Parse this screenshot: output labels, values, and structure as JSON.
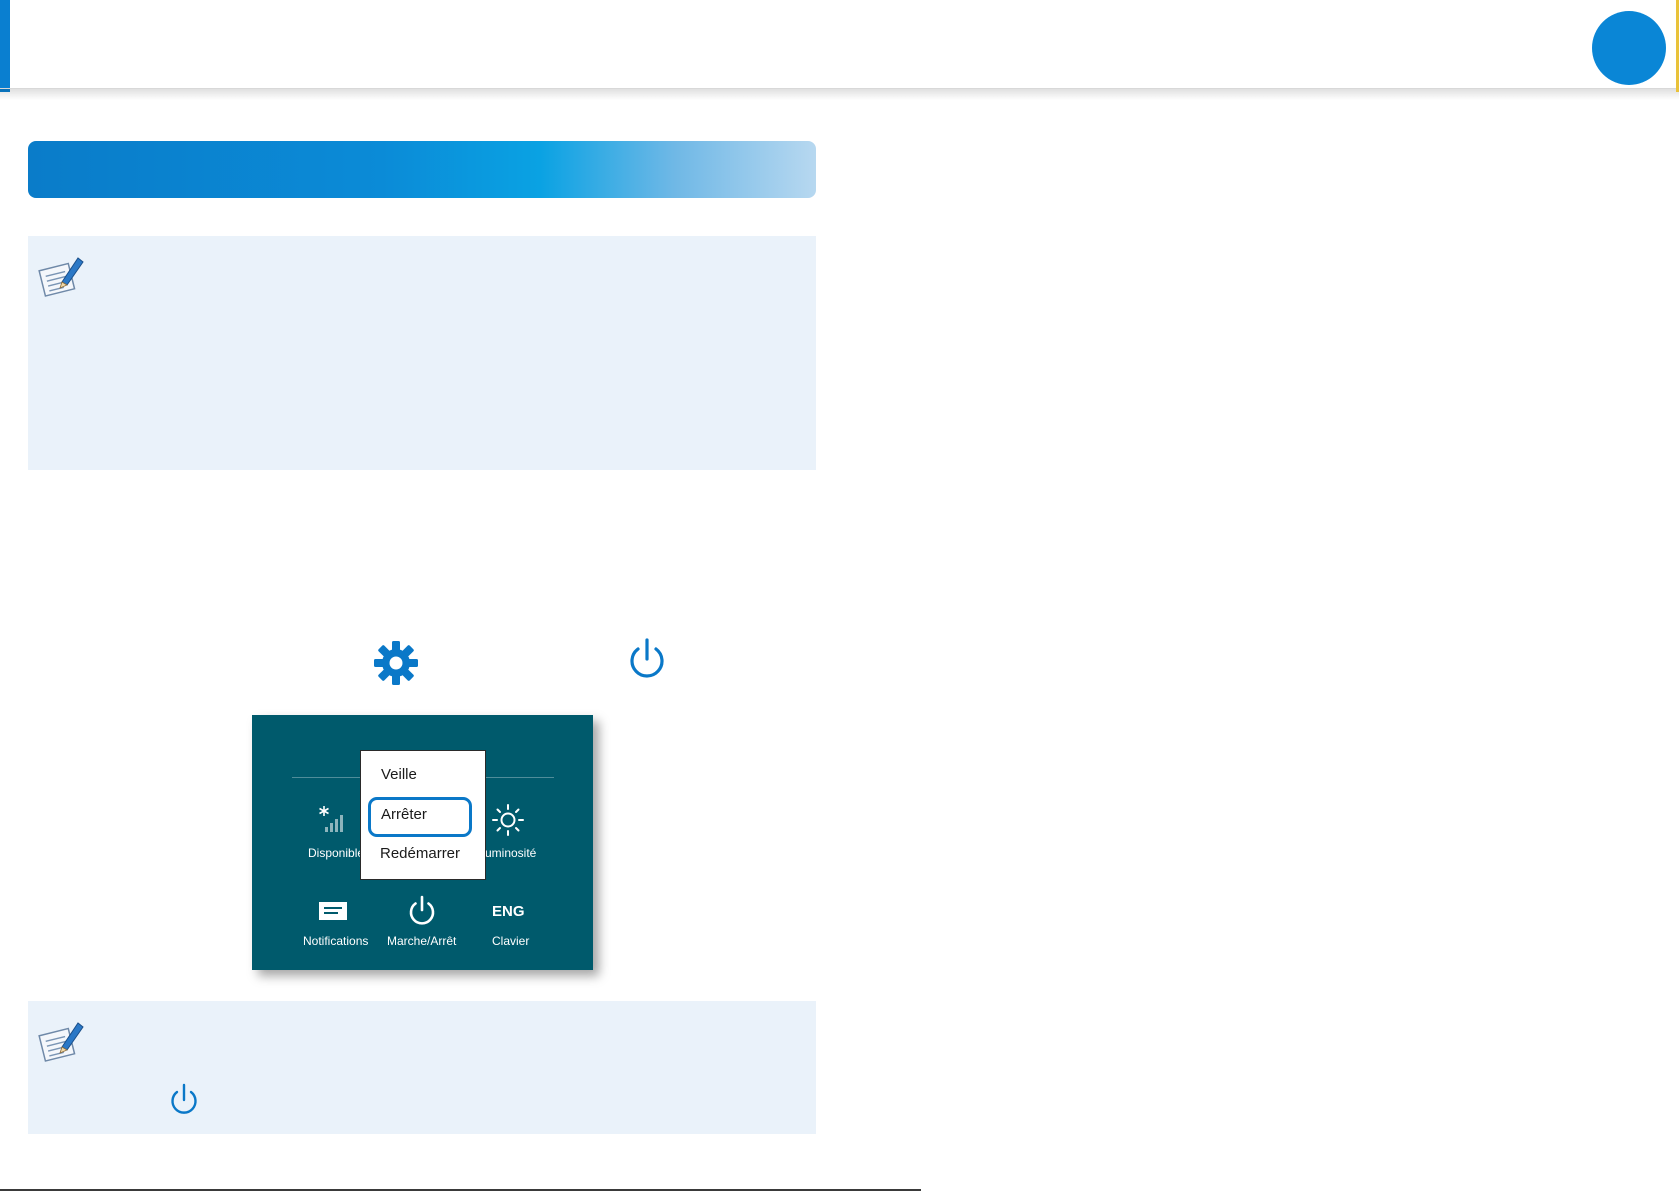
{
  "header": {
    "accent_color": "#0a7fd0",
    "circle_color": "#0a86d6"
  },
  "section_bar": {
    "color": "#0a86d6"
  },
  "note_boxes": [
    {
      "icon": "note-pencil-icon"
    },
    {
      "icon": "note-pencil-icon",
      "inline_icon": "power-icon"
    }
  ],
  "instruction_icons": [
    "settings-gear-icon",
    "power-icon"
  ],
  "settings_panel": {
    "background": "#005a6c",
    "tiles": [
      {
        "label": "Disponible",
        "icon": "wireless-signal-icon"
      },
      {
        "label": "uminosité",
        "icon": "brightness-icon"
      },
      {
        "label": "Notifications",
        "icon": "notifications-icon"
      },
      {
        "label": "Marche/Arrêt",
        "icon": "power-icon"
      },
      {
        "label": "Clavier",
        "icon_text": "ENG"
      }
    ],
    "power_menu": {
      "items": [
        "Veille",
        "Arrêter",
        "Redémarrer"
      ],
      "highlighted": "Arrêter",
      "highlight_color": "#0a78c8"
    }
  }
}
